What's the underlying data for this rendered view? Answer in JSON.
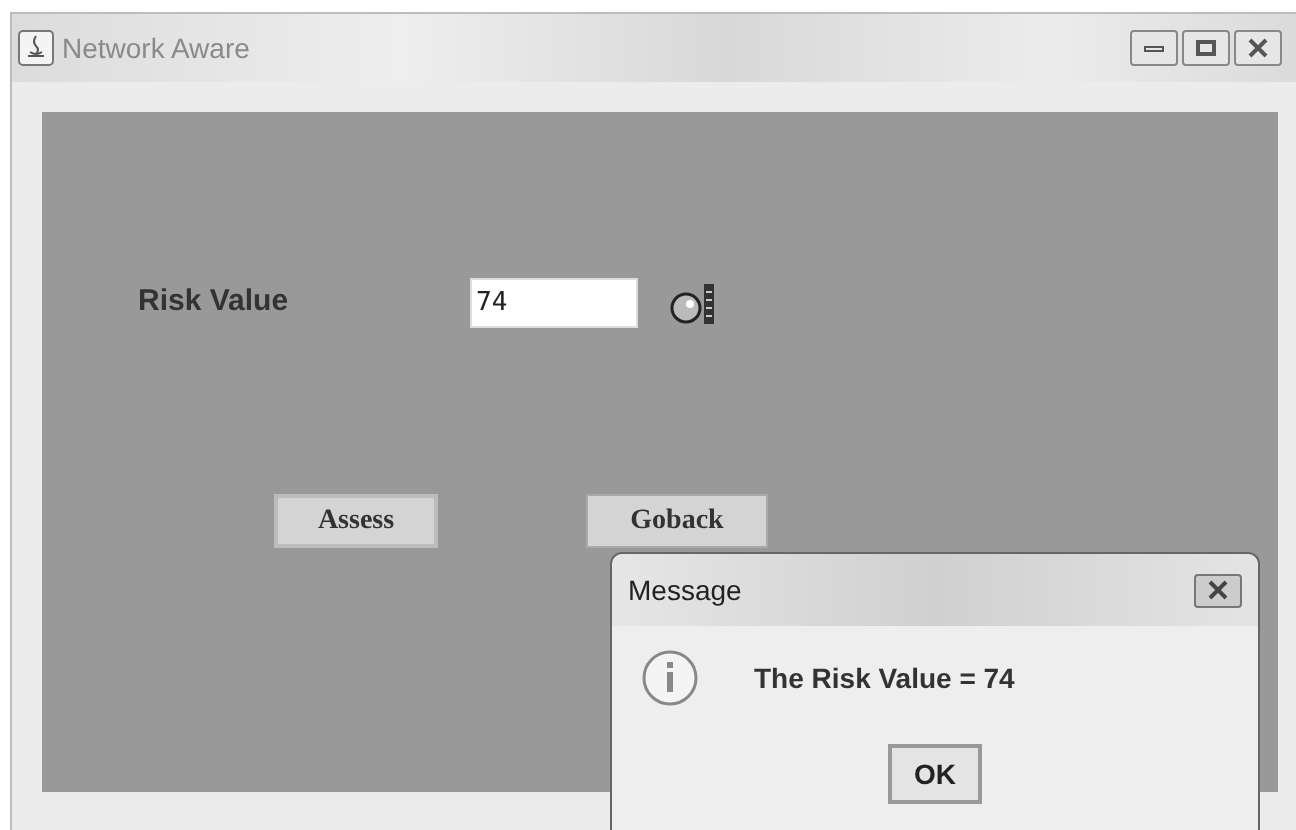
{
  "window": {
    "title": "Network Aware"
  },
  "form": {
    "label": "Risk Value",
    "value": "74"
  },
  "buttons": [
    "Assess",
    "Goback"
  ],
  "dialog": {
    "title": "Message",
    "message": "The Risk Value = 74",
    "button": "OK"
  }
}
